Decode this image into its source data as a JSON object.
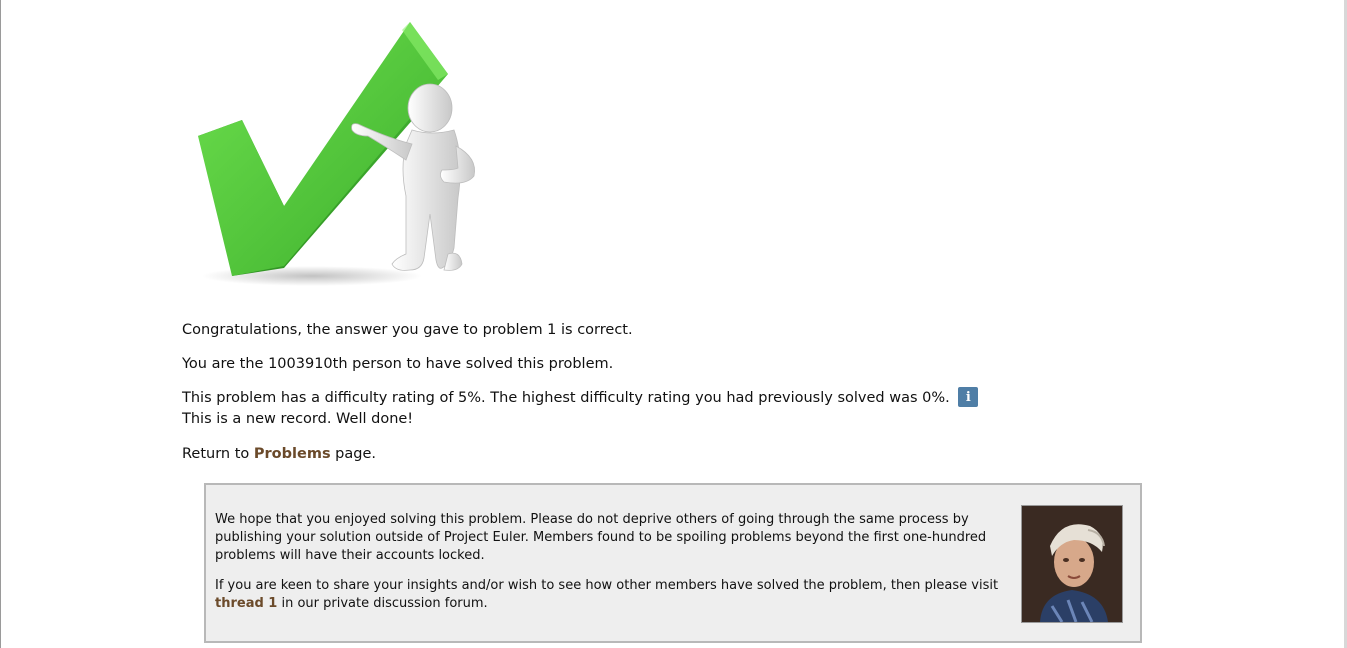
{
  "messages": {
    "congrats": "Congratulations, the answer you gave to problem 1 is correct.",
    "position": "You are the 1003910th person to have solved this problem.",
    "difficulty": "This problem has a difficulty rating of 5%. The highest difficulty rating you had previously solved was 0%.",
    "record": "This is a new record. Well done!",
    "return_prefix": "Return to ",
    "return_link": "Problems",
    "return_suffix": " page."
  },
  "notice": {
    "paragraph1": "We hope that you enjoyed solving this problem. Please do not deprive others of going through the same process by publishing your solution outside of Project Euler. Members found to be spoiling problems beyond the first one-hundred problems will have their accounts locked.",
    "paragraph2_prefix": "If you are keen to share your insights and/or wish to see how other members have solved the problem, then please visit ",
    "thread_link": "thread 1",
    "paragraph2_suffix": " in our private discussion forum."
  },
  "icons": {
    "info": "i"
  },
  "colors": {
    "link": "#6b4a2a",
    "info_badge": "#4f7ea6",
    "check_green": "#4fc43a",
    "notice_bg": "#eeeeee"
  }
}
